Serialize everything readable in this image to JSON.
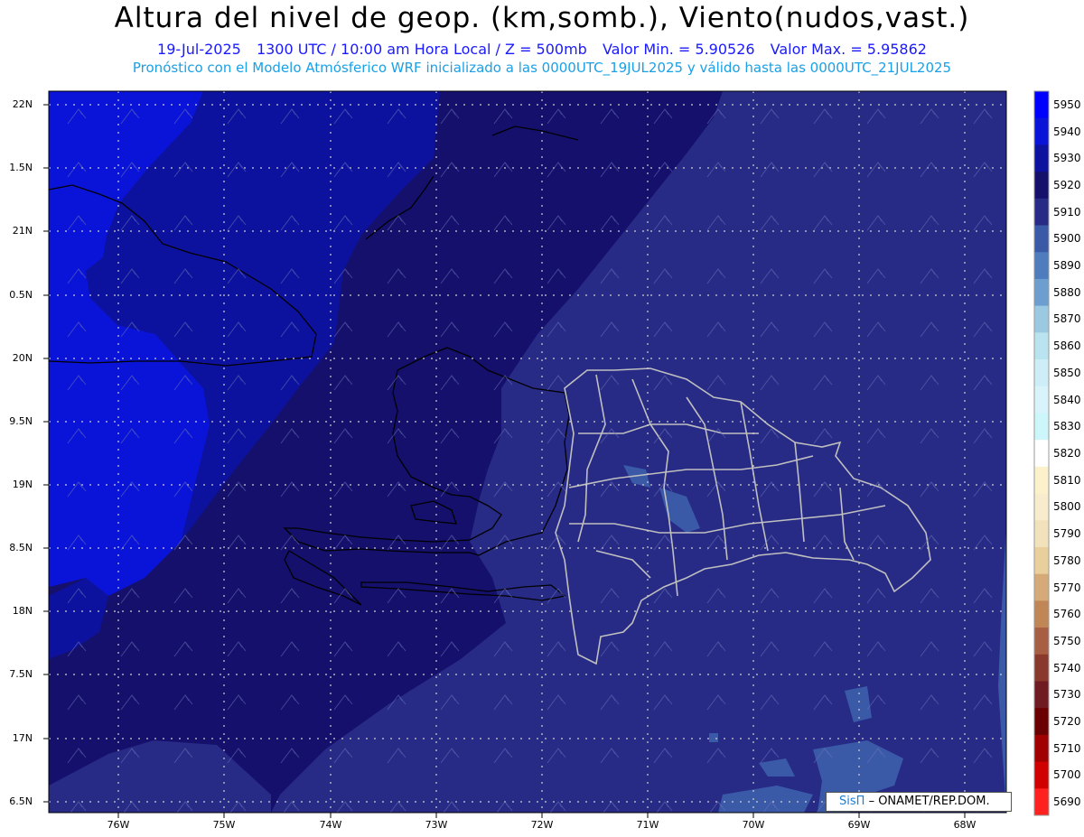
{
  "title": "Altura del nivel de geop. (km,somb.), Viento(nudos,vast.)",
  "subtitle": {
    "date": "19-Jul-2025",
    "time": "1300 UTC / 10:00 am Hora Local / Z = 500mb",
    "min": "Valor Min. = 5.90526",
    "max": "Valor Max. = 5.95862"
  },
  "model_line": "Pronóstico con el Modelo Atmósferico WRF inicializado a las 0000UTC_19JUL2025 y válido hasta las  0000UTC_21JUL2025",
  "lat_labels": [
    "22N",
    "1.5N",
    "21N",
    "0.5N",
    "20N",
    "9.5N",
    "19N",
    "8.5N",
    "18N",
    "7.5N",
    "17N",
    "6.5N"
  ],
  "lon_labels": [
    "76W",
    "75W",
    "74W",
    "73W",
    "72W",
    "71W",
    "70W",
    "69W",
    "68W"
  ],
  "colorbar": {
    "labels": [
      "5950",
      "5940",
      "5930",
      "5920",
      "5910",
      "5900",
      "5890",
      "5880",
      "5870",
      "5860",
      "5850",
      "5840",
      "5830",
      "5820",
      "5810",
      "5800",
      "5790",
      "5780",
      "5770",
      "5760",
      "5750",
      "5740",
      "5730",
      "5720",
      "5710",
      "5700",
      "5690"
    ],
    "colors": [
      "#0000ff",
      "#0a14d8",
      "#0d129e",
      "#14106c",
      "#272b86",
      "#3a5aa8",
      "#4f7cbd",
      "#6c9fcf",
      "#9cc9e2",
      "#b9e3ef",
      "#cdeef6",
      "#d9f3fa",
      "#cdf6fb",
      "#ffffff",
      "#fbf2cc",
      "#f7eccb",
      "#f2e2bc",
      "#e8cf9c",
      "#d5a978",
      "#c08656",
      "#a85e42",
      "#8a3a2c",
      "#701a22",
      "#6a0000",
      "#a00000",
      "#d00000",
      "#ff2020"
    ]
  },
  "credit": {
    "brand": "SisΠ",
    "org": "– ONAMET/REP.DOM."
  },
  "palette": {
    "deep_blue": "#0a14d8",
    "navy": "#14106c",
    "purple_navy": "#25287e",
    "steel_blue": "#3a5aa8",
    "border_land": "#bfbfbf"
  }
}
